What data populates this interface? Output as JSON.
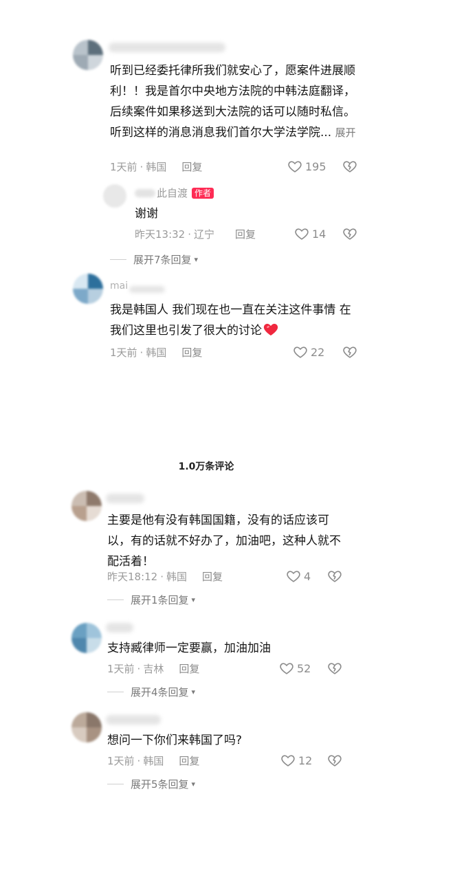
{
  "comment_count": "1.0万条评论",
  "comments": [
    {
      "content": "听到已经委托律所我们就安心了，愿案件进展顺利！！我是首尔中央地方法院的中韩法庭翻译，后续案件如果移送到大法院的话可以随时私信。听到这样的消息消息我们首尔大学法学院...",
      "expand": "展开",
      "time": "1天前",
      "location": "韩国",
      "reply": "回复",
      "likes": "195",
      "avatar_colors": [
        "#b9c3cb",
        "#5d6f7c",
        "#9eaab4",
        "#cfd6dc"
      ]
    },
    {
      "content": "我是韩国人 我们现在也一直在关注这件事情 在我们这里也引发了很大的讨论",
      "name_fragment": "mai",
      "time": "1天前",
      "location": "韩国",
      "reply": "回复",
      "likes": "22",
      "avatar_colors": [
        "#d9e8f2",
        "#2d6f9c",
        "#7da9c9",
        "#b7cfe0"
      ]
    },
    {
      "content": "主要是他有没有韩国国籍，没有的话应该可以，有的话就不好办了，加油吧，这种人就不配活着！",
      "time": "昨天18:12",
      "location": "韩国",
      "reply": "回复",
      "likes": "4",
      "avatar_colors": [
        "#cbbdb2",
        "#8f7a6c",
        "#b8a08e",
        "#e6dcd4"
      ]
    },
    {
      "content": "支持臧律师一定要赢，加油加油",
      "time": "1天前",
      "location": "吉林",
      "reply": "回复",
      "likes": "52",
      "avatar_colors": [
        "#6aa0c2",
        "#9fc4db",
        "#4f87ad",
        "#c8dde9"
      ]
    },
    {
      "content": "想问一下你们来韩国了吗?",
      "time": "1天前",
      "location": "韩国",
      "reply": "回复",
      "likes": "12",
      "avatar_colors": [
        "#bcaa9b",
        "#8a776a",
        "#d8cbc0",
        "#a89282"
      ]
    }
  ],
  "author_reply": {
    "name_fragment": "此自渡",
    "badge": "作者",
    "content": "谢谢",
    "time": "昨天13:32",
    "location": "辽宁",
    "reply": "回复",
    "likes": "14"
  },
  "expand_replies": [
    "展开7条回复",
    "展开1条回复",
    "展开4条回复",
    "展开5条回复"
  ],
  "separator": "·"
}
